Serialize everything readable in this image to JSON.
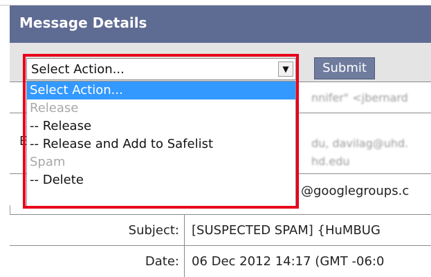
{
  "header": {
    "title": "Message Details"
  },
  "action_select": {
    "value": "Select Action...",
    "options": [
      {
        "label": "Select Action...",
        "type": "selected"
      },
      {
        "label": "Release",
        "type": "group"
      },
      {
        "label": "-- Release",
        "type": "item"
      },
      {
        "label": "-- Release and Add to Safelist",
        "type": "item"
      },
      {
        "label": "Spam",
        "type": "group"
      },
      {
        "label": "-- Delete",
        "type": "item"
      }
    ]
  },
  "submit": {
    "label": "Submit"
  },
  "rows": {
    "row1": {
      "value_partial": "nnifer\" <jbernard"
    },
    "row2": {
      "label_partial": "E",
      "value_line1": "du, davilag@uhd.",
      "value_line2": "hd.edu"
    },
    "row3": {
      "value": "@googlegroups.c"
    },
    "subject": {
      "label": "Subject:",
      "value": "[SUSPECTED SPAM] {HuMBUG"
    },
    "date": {
      "label": "Date:",
      "value": "06 Dec 2012 14:17 (GMT -06:0"
    }
  },
  "colors": {
    "header_bg": "#5e6b93",
    "highlight": "#e8001c",
    "selected": "#3399ff"
  }
}
